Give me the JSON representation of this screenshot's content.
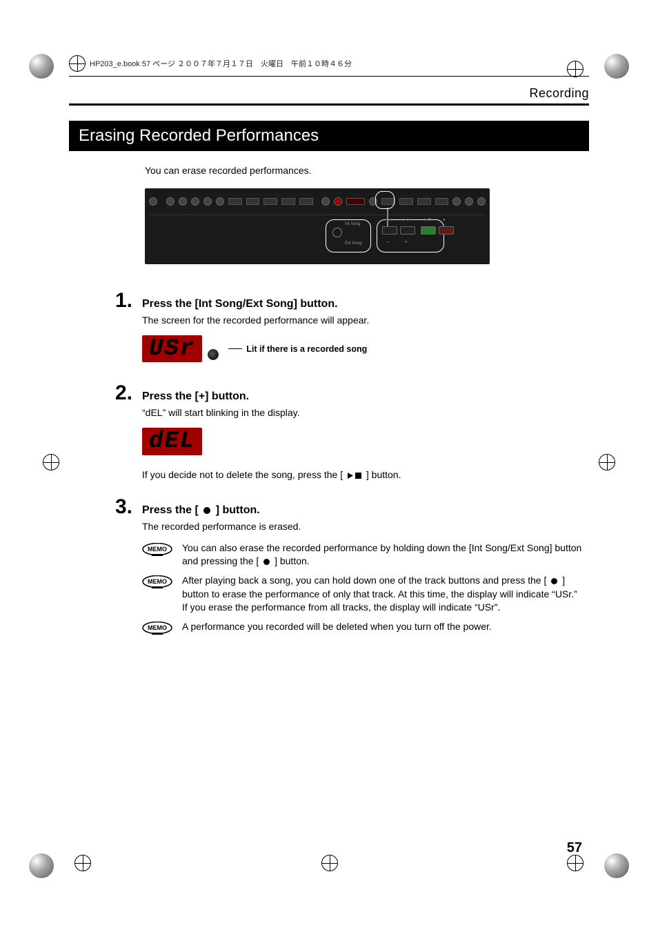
{
  "file_header": "HP203_e.book  57 ページ  ２００７年７月１７日　火曜日　午前１０時４６分",
  "section_label": "Recording",
  "banner_title": "Erasing Recorded Performances",
  "intro": "You can erase recorded performances.",
  "panel": {
    "int_song_label": "Int Song",
    "ext_song_label": "Ext Song"
  },
  "steps": {
    "s1": {
      "num": "1.",
      "title": "Press the [Int Song/Ext Song] button.",
      "text": "The screen for the recorded performance will appear.",
      "display_value": "USr",
      "caption": "Lit if there is a recorded song"
    },
    "s2": {
      "num": "2.",
      "title": "Press the [+] button.",
      "text": "“dEL” will start blinking in the display.",
      "display_value": "dEL",
      "note_pre": "If you decide not to delete the song, press the [ ",
      "note_post": " ] button."
    },
    "s3": {
      "num": "3.",
      "title_pre": "Press the [ ",
      "title_post": " ] button.",
      "text": "The recorded performance is erased."
    }
  },
  "memos": {
    "m1_pre": "You can also erase the recorded performance by holding down the [Int Song/Ext Song] button and pressing the [ ",
    "m1_post": " ] button.",
    "m2_pre": "After playing back a song, you can hold down one of the track buttons and press the [ ",
    "m2_post": " ] button to erase the performance of only that track. At this time, the display will indicate “USr.” If you erase the performance from all tracks, the display will indicate “USr”.",
    "m3": "A performance you recorded will be deleted when you turn off the power."
  },
  "page_number": "57",
  "icons": {
    "memo_label": "MEMO"
  }
}
